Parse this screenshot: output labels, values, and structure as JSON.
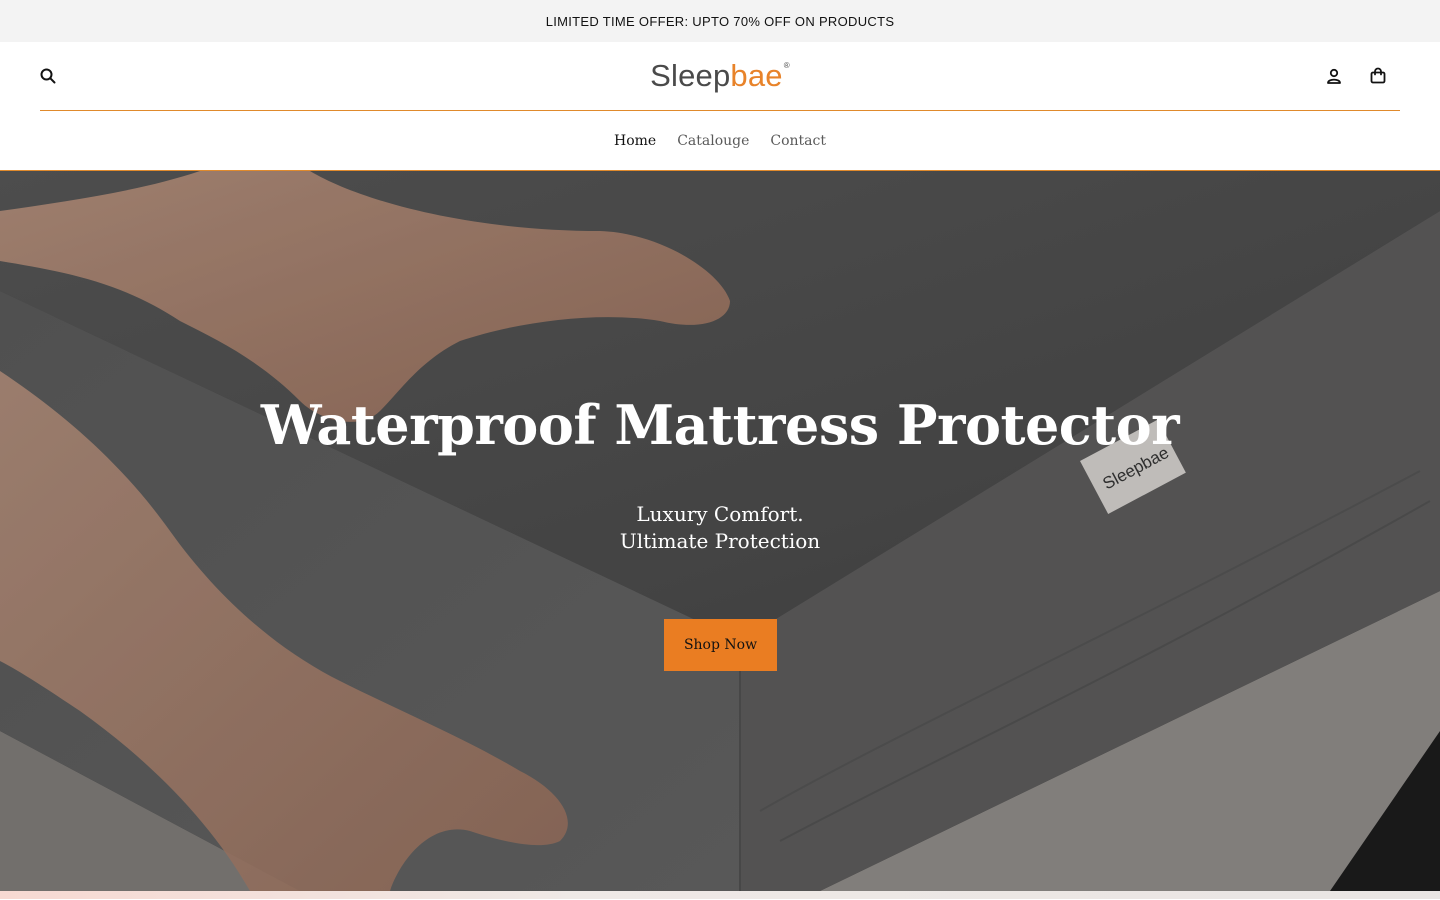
{
  "announcement": {
    "text": "LIMITED TIME OFFER: UPTO 70% OFF ON PRODUCTS"
  },
  "header": {
    "logo_part1": "Sleep",
    "logo_part2": "bae",
    "logo_mark": "®",
    "icons": [
      "search-icon",
      "account-icon",
      "cart-icon"
    ]
  },
  "nav": {
    "items": [
      {
        "label": "Home",
        "active": true
      },
      {
        "label": "Catalouge",
        "active": false
      },
      {
        "label": "Contact",
        "active": false
      }
    ]
  },
  "hero": {
    "title": "Waterproof Mattress Protector",
    "subtitle_line1": "Luxury Comfort.",
    "subtitle_line2": "Ultimate Protection",
    "button_label": "Shop Now",
    "tag_text": "Sleepbae"
  },
  "colors": {
    "accent": "#ea7d22",
    "logo_grey": "#4a4a4a",
    "announcement_bg": "#f3f3f3",
    "divider": "#e08a2c"
  }
}
